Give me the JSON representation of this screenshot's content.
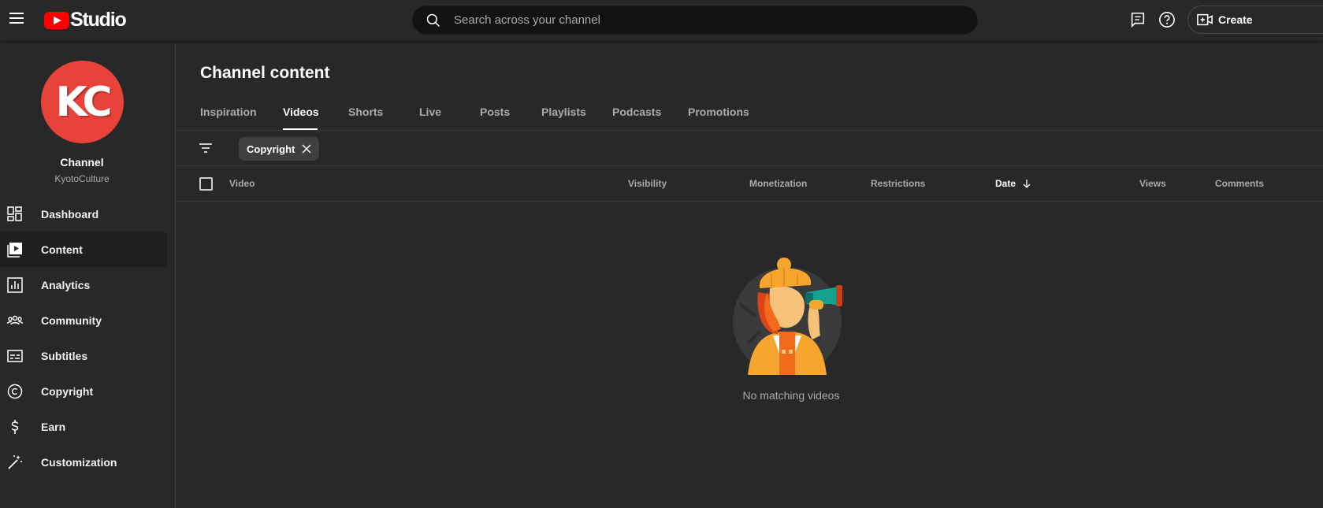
{
  "app": {
    "logo_text": "Studio"
  },
  "search": {
    "placeholder": "Search across your channel"
  },
  "header": {
    "create_label": "Create"
  },
  "channel": {
    "initials": "KC",
    "name": "Channel",
    "handle": "KyotoCulture",
    "avatar_color": "#e8433a"
  },
  "sidebar": {
    "items": [
      {
        "label": "Dashboard",
        "icon": "dashboard-icon"
      },
      {
        "label": "Content",
        "icon": "content-icon",
        "active": true
      },
      {
        "label": "Analytics",
        "icon": "analytics-icon"
      },
      {
        "label": "Community",
        "icon": "community-icon"
      },
      {
        "label": "Subtitles",
        "icon": "subtitles-icon"
      },
      {
        "label": "Copyright",
        "icon": "copyright-icon"
      },
      {
        "label": "Earn",
        "icon": "earn-icon"
      },
      {
        "label": "Customization",
        "icon": "customization-icon"
      }
    ]
  },
  "main": {
    "title": "Channel content",
    "tabs": [
      {
        "label": "Inspiration"
      },
      {
        "label": "Videos",
        "active": true
      },
      {
        "label": "Shorts"
      },
      {
        "label": "Live"
      },
      {
        "label": "Posts"
      },
      {
        "label": "Playlists"
      },
      {
        "label": "Podcasts"
      },
      {
        "label": "Promotions"
      }
    ],
    "filter_chip": {
      "label": "Copyright"
    },
    "columns": [
      {
        "label": "Video"
      },
      {
        "label": "Visibility"
      },
      {
        "label": "Monetization"
      },
      {
        "label": "Restrictions"
      },
      {
        "label": "Date",
        "sorted": true,
        "sort_direction": "descending"
      },
      {
        "label": "Views"
      },
      {
        "label": "Comments"
      }
    ],
    "empty_message": "No matching videos"
  },
  "colors": {
    "background": "#282828",
    "accent_red": "#ff0000",
    "search_bg": "#121212"
  }
}
